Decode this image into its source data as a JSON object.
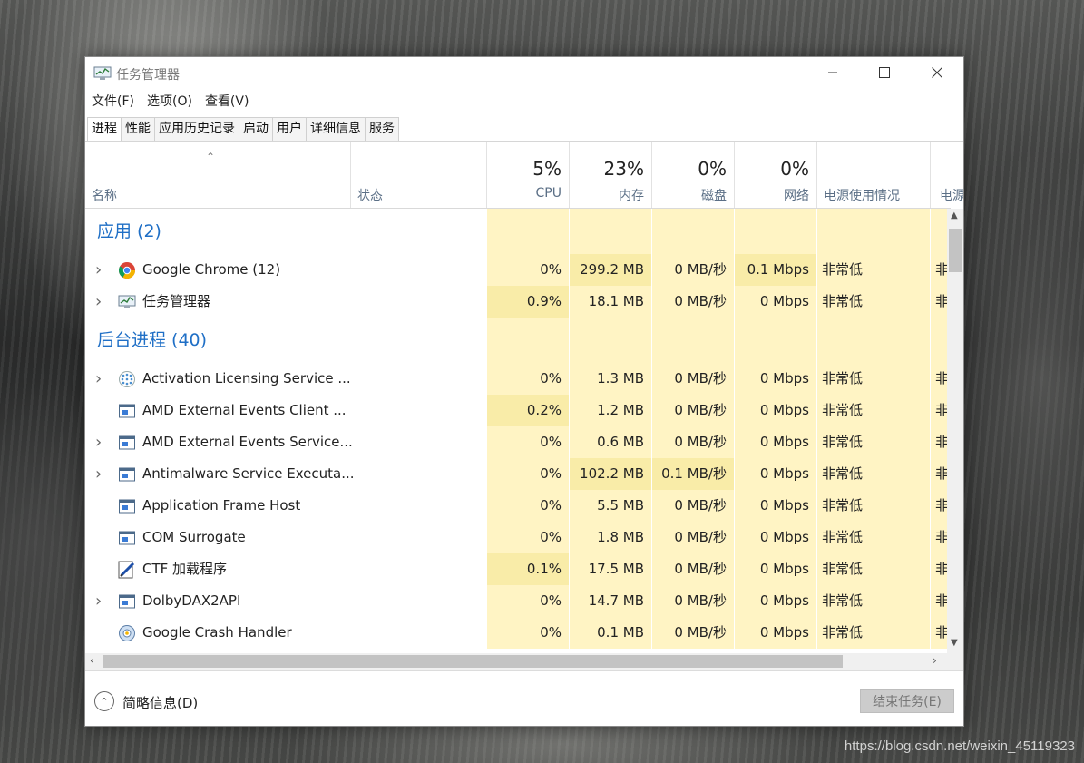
{
  "watermark": "https://blog.csdn.net/weixin_45119323",
  "window": {
    "title": "任务管理器",
    "menu": [
      "文件(F)",
      "选项(O)",
      "查看(V)"
    ],
    "tabs": [
      "进程",
      "性能",
      "应用历史记录",
      "启动",
      "用户",
      "详细信息",
      "服务"
    ],
    "active_tab": "进程"
  },
  "columns": {
    "name": "名称",
    "status": "状态",
    "cpu": {
      "pct": "5%",
      "label": "CPU"
    },
    "memory": {
      "pct": "23%",
      "label": "内存"
    },
    "disk": {
      "pct": "0%",
      "label": "磁盘"
    },
    "network": {
      "pct": "0%",
      "label": "网络"
    },
    "power": "电源使用情况",
    "power_trend": "电源"
  },
  "groups": [
    {
      "title": "应用 (2)",
      "rows": [
        {
          "name": "Google Chrome (12)",
          "icon": "chrome-icon",
          "expandable": true,
          "cpu": "0%",
          "mem": "299.2 MB",
          "disk": "0 MB/秒",
          "net": "0.1 Mbps",
          "power": "非常低",
          "power_trend": "非",
          "hot": [
            "mem",
            "net"
          ]
        },
        {
          "name": "任务管理器",
          "icon": "task-manager-icon",
          "expandable": true,
          "cpu": "0.9%",
          "mem": "18.1 MB",
          "disk": "0 MB/秒",
          "net": "0 Mbps",
          "power": "非常低",
          "power_trend": "非",
          "hot": [
            "cpu"
          ]
        }
      ]
    },
    {
      "title": "后台进程 (40)",
      "rows": [
        {
          "name": "Activation Licensing Service ...",
          "icon": "service-dots-icon",
          "expandable": true,
          "cpu": "0%",
          "mem": "1.3 MB",
          "disk": "0 MB/秒",
          "net": "0 Mbps",
          "power": "非常低",
          "power_trend": "非",
          "hot": []
        },
        {
          "name": "AMD External Events Client ...",
          "icon": "window-icon",
          "expandable": false,
          "cpu": "0.2%",
          "mem": "1.2 MB",
          "disk": "0 MB/秒",
          "net": "0 Mbps",
          "power": "非常低",
          "power_trend": "非",
          "hot": [
            "cpu"
          ]
        },
        {
          "name": "AMD External Events Service...",
          "icon": "window-icon",
          "expandable": true,
          "cpu": "0%",
          "mem": "0.6 MB",
          "disk": "0 MB/秒",
          "net": "0 Mbps",
          "power": "非常低",
          "power_trend": "非",
          "hot": []
        },
        {
          "name": "Antimalware Service Executa...",
          "icon": "window-icon",
          "expandable": true,
          "cpu": "0%",
          "mem": "102.2 MB",
          "disk": "0.1 MB/秒",
          "net": "0 Mbps",
          "power": "非常低",
          "power_trend": "非",
          "hot": [
            "mem",
            "disk"
          ]
        },
        {
          "name": "Application Frame Host",
          "icon": "window-icon",
          "expandable": false,
          "cpu": "0%",
          "mem": "5.5 MB",
          "disk": "0 MB/秒",
          "net": "0 Mbps",
          "power": "非常低",
          "power_trend": "非",
          "hot": []
        },
        {
          "name": "COM Surrogate",
          "icon": "window-icon",
          "expandable": false,
          "cpu": "0%",
          "mem": "1.8 MB",
          "disk": "0 MB/秒",
          "net": "0 Mbps",
          "power": "非常低",
          "power_trend": "非",
          "hot": []
        },
        {
          "name": "CTF 加载程序",
          "icon": "pen-icon",
          "expandable": false,
          "cpu": "0.1%",
          "mem": "17.5 MB",
          "disk": "0 MB/秒",
          "net": "0 Mbps",
          "power": "非常低",
          "power_trend": "非",
          "hot": [
            "cpu"
          ]
        },
        {
          "name": "DolbyDAX2API",
          "icon": "window-icon",
          "expandable": true,
          "cpu": "0%",
          "mem": "14.7 MB",
          "disk": "0 MB/秒",
          "net": "0 Mbps",
          "power": "非常低",
          "power_trend": "非",
          "hot": []
        },
        {
          "name": "Google Crash Handler",
          "icon": "crash-handler-icon",
          "expandable": false,
          "cpu": "0%",
          "mem": "0.1 MB",
          "disk": "0 MB/秒",
          "net": "0 Mbps",
          "power": "非常低",
          "power_trend": "非",
          "hot": []
        }
      ]
    }
  ],
  "footer": {
    "fewer_details": "简略信息(D)",
    "end_task": "结束任务(E)"
  },
  "colors": {
    "heat_light": "#fff4c4",
    "heat_mid": "#f9eca8",
    "heat_strong": "#ffe9a0",
    "group_title": "#1f6fc6"
  }
}
